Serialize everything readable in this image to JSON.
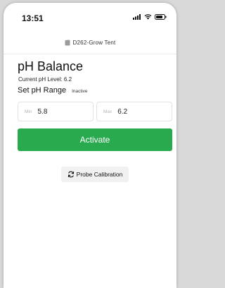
{
  "status_bar": {
    "time": "13:51",
    "icons": [
      "signal-icon",
      "wifi-icon",
      "battery-icon"
    ]
  },
  "header": {
    "device_name": "D262-Grow Tent",
    "icon": "device-icon"
  },
  "page": {
    "title": "pH Balance",
    "current_level_label": "Current pH Level: 6.2",
    "set_range_label": "Set pH Range",
    "status": "Inactive"
  },
  "range": {
    "min_placeholder": "Min",
    "min_value": "5.8",
    "max_placeholder": "Max",
    "max_value": "6.2"
  },
  "actions": {
    "activate_label": "Activate",
    "calibration_label": "Probe Calibration",
    "calibration_icon": "refresh-icon"
  },
  "colors": {
    "accent_green": "#2aaa4f",
    "background": "#ffffff"
  }
}
